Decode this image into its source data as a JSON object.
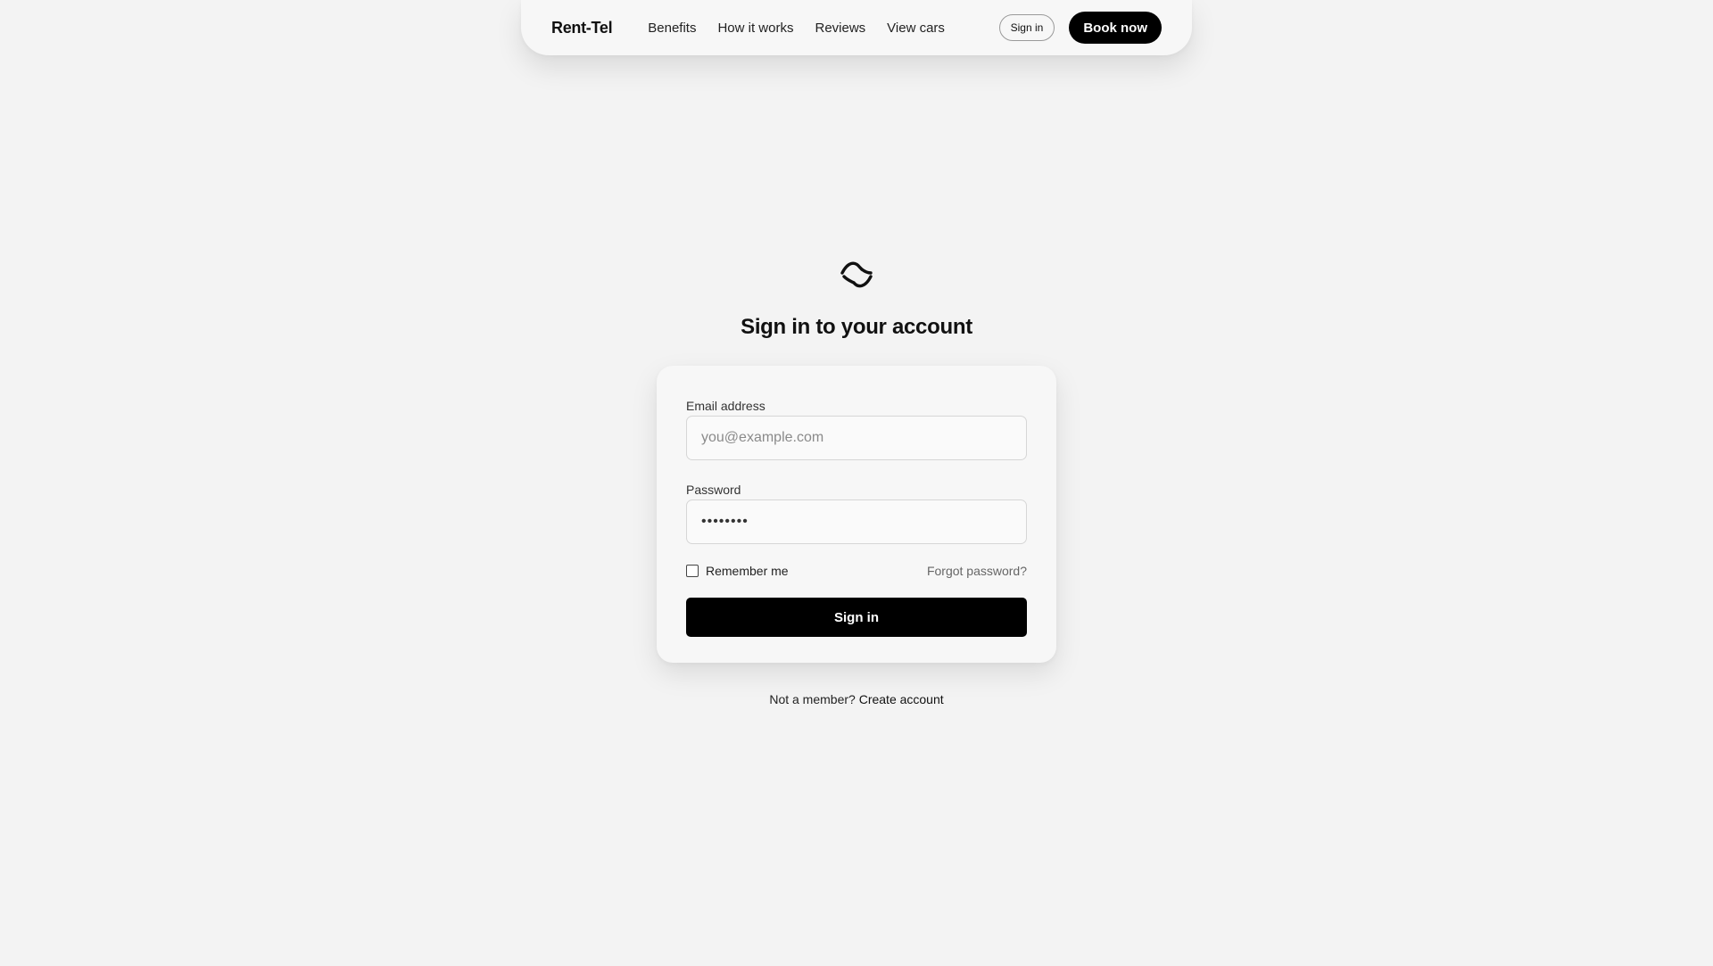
{
  "nav": {
    "brand": "Rent-Tel",
    "links": [
      "Benefits",
      "How it works",
      "Reviews",
      "View cars"
    ],
    "sign_in_label": "Sign in",
    "book_label": "Book now"
  },
  "auth": {
    "logo_icon": "wave-logo-icon",
    "title": "Sign in to your account",
    "email": {
      "label": "Email address",
      "placeholder": "you@example.com",
      "value": ""
    },
    "password": {
      "label": "Password",
      "value": "••••••••"
    },
    "remember_label": "Remember me",
    "remember_checked": false,
    "forgot_label": "Forgot password?",
    "submit_label": "Sign in",
    "footer_prompt": "Not a member?",
    "footer_link": "Create account"
  },
  "colors": {
    "background": "#f3f3f3",
    "card": "#f7f7f7",
    "primary": "#000000"
  }
}
